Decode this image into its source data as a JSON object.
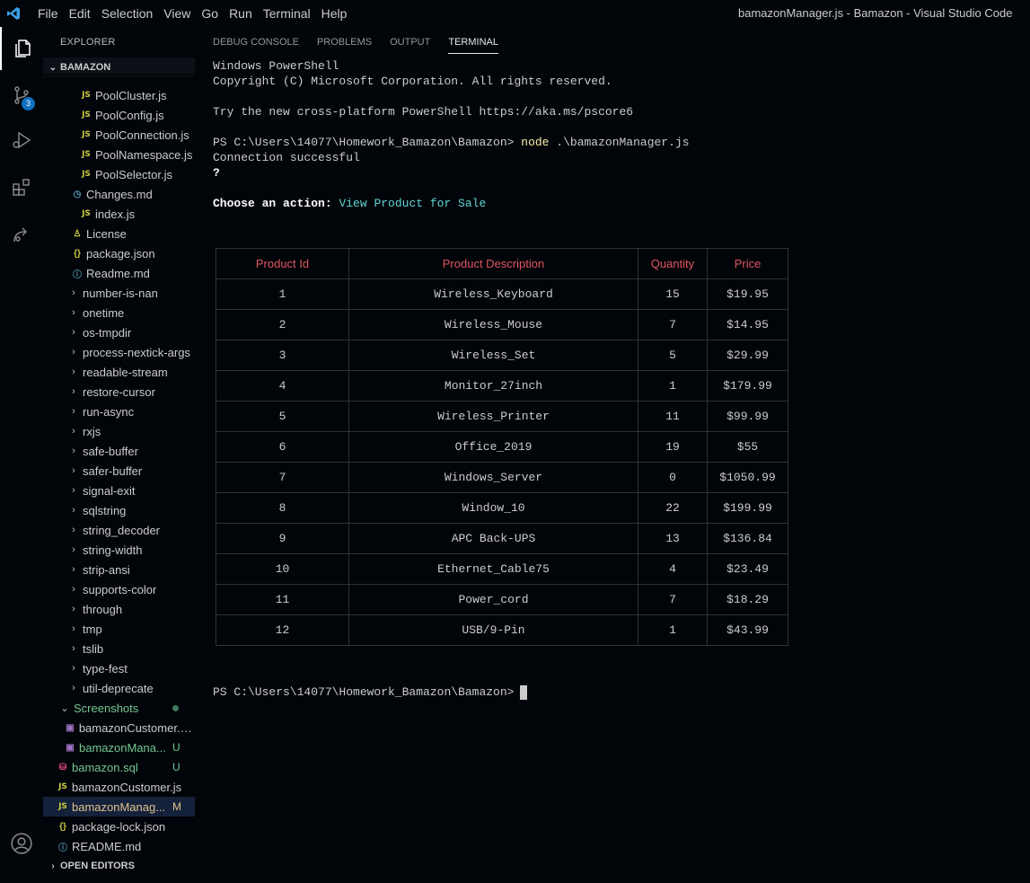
{
  "menu": [
    "File",
    "Edit",
    "Selection",
    "View",
    "Go",
    "Run",
    "Terminal",
    "Help"
  ],
  "window_title": "bamazonManager.js - Bamazon - Visual Studio Code",
  "activity": {
    "scm_badge": "3"
  },
  "sidebar": {
    "title": "EXPLORER",
    "project": "BAMAZON",
    "open_editors": "OPEN EDITORS",
    "items": [
      {
        "icon": "js",
        "label": "PoolCluster.js"
      },
      {
        "icon": "js",
        "label": "PoolConfig.js"
      },
      {
        "icon": "js",
        "label": "PoolConnection.js"
      },
      {
        "icon": "js",
        "label": "PoolNamespace.js"
      },
      {
        "icon": "js",
        "label": "PoolSelector.js"
      },
      {
        "icon": "clock",
        "label": "Changes.md"
      },
      {
        "icon": "js",
        "label": "index.js"
      },
      {
        "icon": "license",
        "label": "License"
      },
      {
        "icon": "json",
        "label": "package.json"
      },
      {
        "icon": "info",
        "label": "Readme.md"
      },
      {
        "icon": "chevron",
        "label": "number-is-nan"
      },
      {
        "icon": "chevron",
        "label": "onetime"
      },
      {
        "icon": "chevron",
        "label": "os-tmpdir"
      },
      {
        "icon": "chevron",
        "label": "process-nextick-args"
      },
      {
        "icon": "chevron",
        "label": "readable-stream"
      },
      {
        "icon": "chevron",
        "label": "restore-cursor"
      },
      {
        "icon": "chevron",
        "label": "run-async"
      },
      {
        "icon": "chevron",
        "label": "rxjs"
      },
      {
        "icon": "chevron",
        "label": "safe-buffer"
      },
      {
        "icon": "chevron",
        "label": "safer-buffer"
      },
      {
        "icon": "chevron",
        "label": "signal-exit"
      },
      {
        "icon": "chevron",
        "label": "sqlstring"
      },
      {
        "icon": "chevron",
        "label": "string_decoder"
      },
      {
        "icon": "chevron",
        "label": "string-width"
      },
      {
        "icon": "chevron",
        "label": "strip-ansi"
      },
      {
        "icon": "chevron",
        "label": "supports-color"
      },
      {
        "icon": "chevron",
        "label": "through"
      },
      {
        "icon": "chevron",
        "label": "tmp"
      },
      {
        "icon": "chevron",
        "label": "tslib"
      },
      {
        "icon": "chevron",
        "label": "type-fest"
      },
      {
        "icon": "chevron",
        "label": "util-deprecate"
      },
      {
        "icon": "chevron-open",
        "label": "Screenshots"
      },
      {
        "icon": "image",
        "label": "bamazonCustomer.P..."
      },
      {
        "icon": "image",
        "label": "bamazonMana...",
        "status": "U"
      },
      {
        "icon": "db",
        "label": "bamazon.sql",
        "status": "U"
      },
      {
        "icon": "js",
        "label": "bamazonCustomer.js"
      },
      {
        "icon": "js",
        "label": "bamazonManag...",
        "status": "M"
      },
      {
        "icon": "json",
        "label": "package-lock.json"
      },
      {
        "icon": "info",
        "label": "README.md"
      }
    ]
  },
  "panel": {
    "tabs": [
      "DEBUG CONSOLE",
      "PROBLEMS",
      "OUTPUT",
      "TERMINAL"
    ],
    "active_tab": "TERMINAL"
  },
  "terminal": {
    "line1": "Windows PowerShell",
    "line2": "Copyright (C) Microsoft Corporation. All rights reserved.",
    "line3": "Try the new cross-platform PowerShell https://aka.ms/pscore6",
    "prompt": "PS C:\\Users\\14077\\Homework_Bamazon\\Bamazon> ",
    "command": "node",
    "command_args": " .\\bamazonManager.js",
    "connected": "Connection successful",
    "question_mark": "?",
    "choose_label": "Choose an action: ",
    "choose_value": "View Product for Sale",
    "prompt_end": "PS C:\\Users\\14077\\Homework_Bamazon\\Bamazon>"
  },
  "table": {
    "headers": [
      "Product Id",
      "Product Description",
      "Quantity",
      "Price"
    ],
    "rows": [
      [
        "1",
        "Wireless_Keyboard",
        "15",
        "$19.95"
      ],
      [
        "2",
        "Wireless_Mouse",
        "7",
        "$14.95"
      ],
      [
        "3",
        "Wireless_Set",
        "5",
        "$29.99"
      ],
      [
        "4",
        "Monitor_27inch",
        "1",
        "$179.99"
      ],
      [
        "5",
        "Wireless_Printer",
        "11",
        "$99.99"
      ],
      [
        "6",
        "Office_2019",
        "19",
        "$55"
      ],
      [
        "7",
        "Windows_Server",
        "0",
        "$1050.99"
      ],
      [
        "8",
        "Window_10",
        "22",
        "$199.99"
      ],
      [
        "9",
        "APC Back-UPS",
        "13",
        "$136.84"
      ],
      [
        "10",
        "Ethernet_Cable75",
        "4",
        "$23.49"
      ],
      [
        "11",
        "Power_cord",
        "7",
        "$18.29"
      ],
      [
        "12",
        "USB/9-Pin",
        "1",
        "$43.99"
      ]
    ]
  }
}
